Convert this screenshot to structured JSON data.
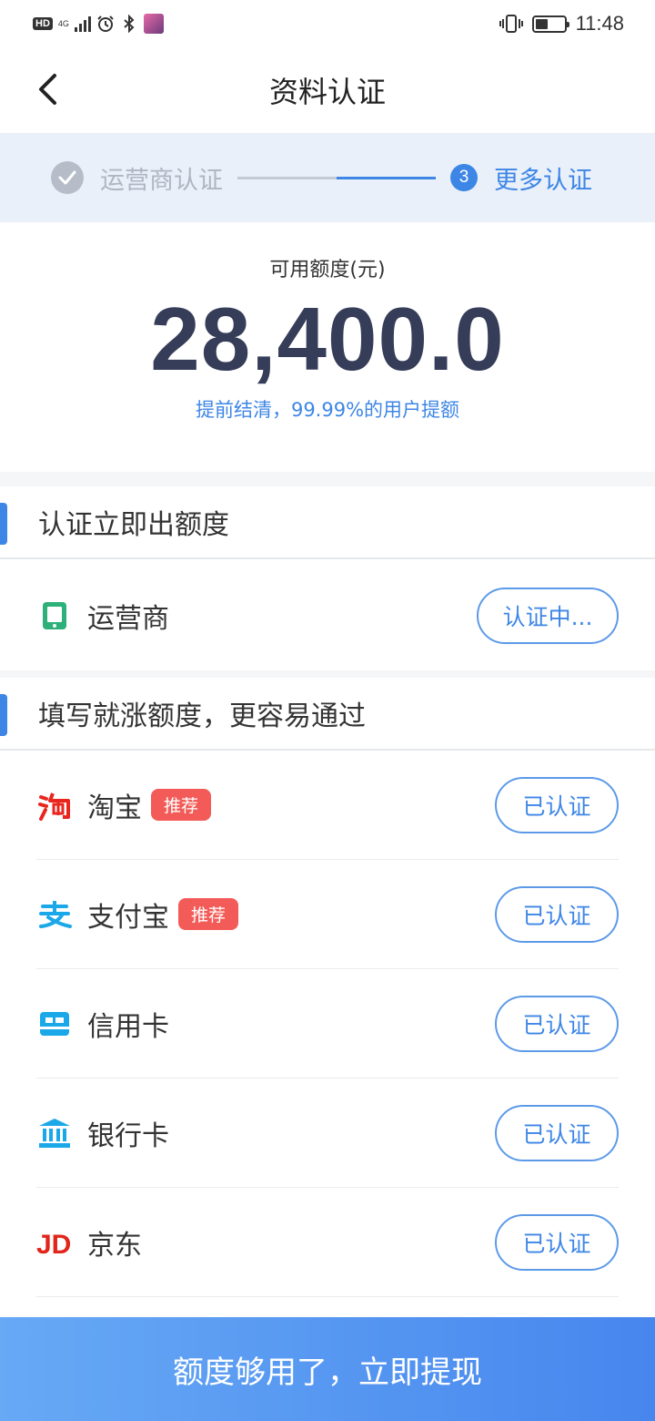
{
  "status_bar": {
    "hd": "HD",
    "network": "4G",
    "time": "11:48",
    "battery_level": 0.45
  },
  "header": {
    "title": "资料认证",
    "back_icon": "chevron-left-icon"
  },
  "steps": {
    "step1_label": "运营商认证",
    "step3_number": "3",
    "step3_label": "更多认证",
    "progress": 0.5
  },
  "amount": {
    "label": "可用额度(元)",
    "value": "28,400.0",
    "tip": "提前结清，99.99%的用户提额"
  },
  "section1": {
    "title": "认证立即出额度",
    "items": [
      {
        "label": "运营商",
        "icon": "phone-icon",
        "button": "认证中..."
      }
    ]
  },
  "section2": {
    "title": "填写就涨额度，更容易通过",
    "items": [
      {
        "label": "淘宝",
        "icon": "taobao-icon",
        "tag": "推荐",
        "button": "已认证"
      },
      {
        "label": "支付宝",
        "icon": "alipay-icon",
        "tag": "推荐",
        "button": "已认证"
      },
      {
        "label": "信用卡",
        "icon": "credit-card-icon",
        "button": "已认证"
      },
      {
        "label": "银行卡",
        "icon": "bank-icon",
        "button": "已认证"
      },
      {
        "label": "京东",
        "icon": "jd-icon",
        "logo_text": "JD",
        "button": "已认证"
      }
    ]
  },
  "cta": {
    "label": "额度够用了，立即提现"
  },
  "colors": {
    "accent": "#3e86e6",
    "amount": "#363d59",
    "tag": "#f25b57",
    "steps_bg": "#e9f0f9"
  }
}
